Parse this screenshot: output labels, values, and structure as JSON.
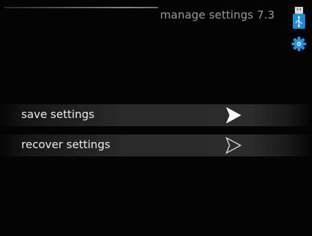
{
  "header": {
    "title": "manage settings 7.3"
  },
  "status_icons": {
    "usb": "usb-icon",
    "settings": "gear-icon"
  },
  "menu": {
    "items": [
      {
        "label": "save settings",
        "arrow": "arrow-right-filled-icon",
        "state": "selected"
      },
      {
        "label": "recover settings",
        "arrow": "arrow-right-outline-icon",
        "state": "normal"
      }
    ]
  },
  "colors": {
    "background": "#040404",
    "text": "#ececec",
    "title": "#9a9a9a",
    "accent_blue": "#1f8ad0"
  }
}
